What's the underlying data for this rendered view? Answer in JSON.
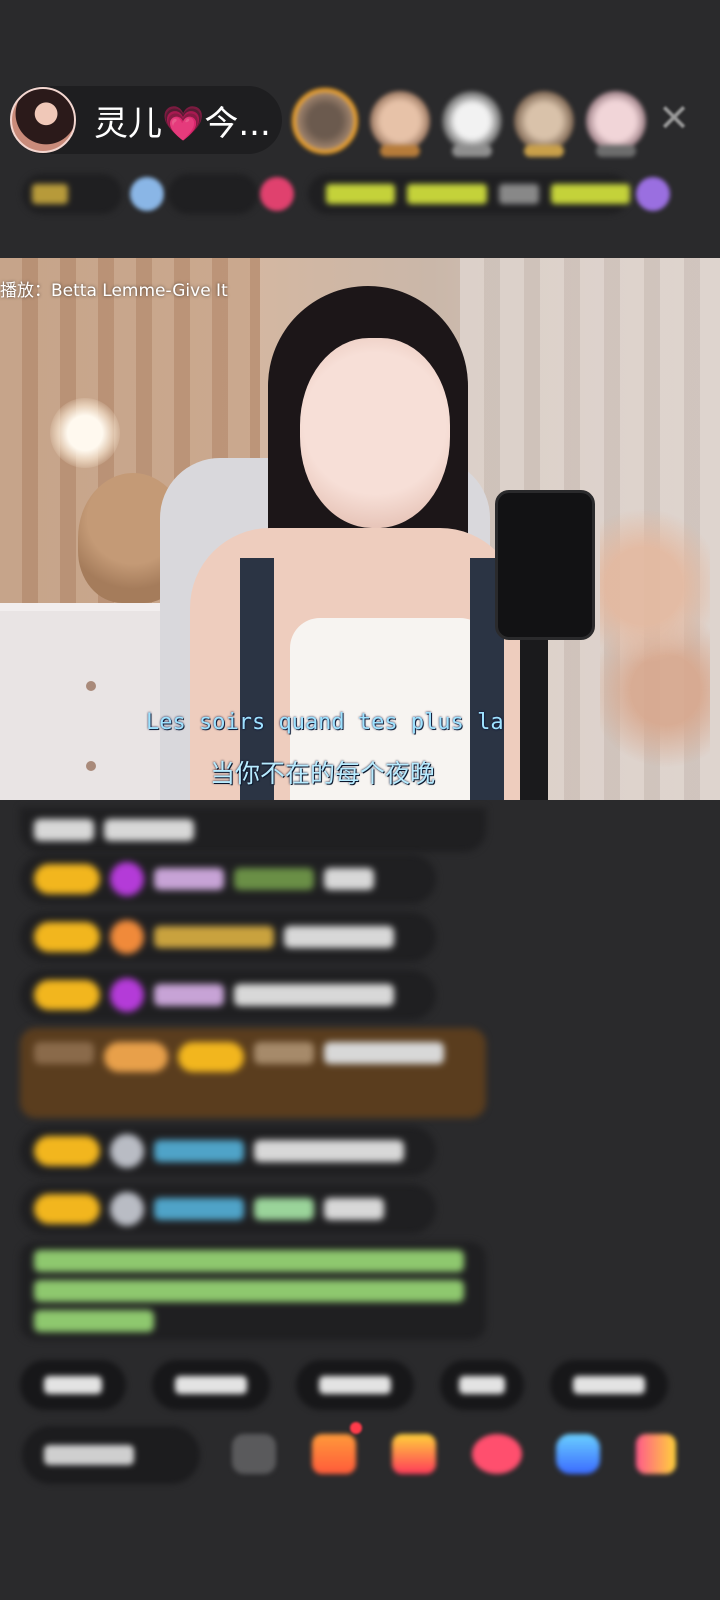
{
  "header": {
    "host_name": "灵儿💗今...",
    "close_glyph": "✕"
  },
  "video": {
    "now_playing": "播放：Betta Lemme-Give It",
    "subtitle_en": "Les soirs quand tes plus la",
    "subtitle_zh": "当你不在的每个夜晚"
  },
  "colors": {
    "background": "#2a2a2c",
    "level_badge": "#f2b61e",
    "gift_badge": "#ff3b4a",
    "subtitle": "#9fe3ff"
  },
  "icons": [
    "close-icon",
    "emoji-icon",
    "gift-icon",
    "coupon-icon",
    "heart-icon",
    "game-icon",
    "more-icon"
  ]
}
